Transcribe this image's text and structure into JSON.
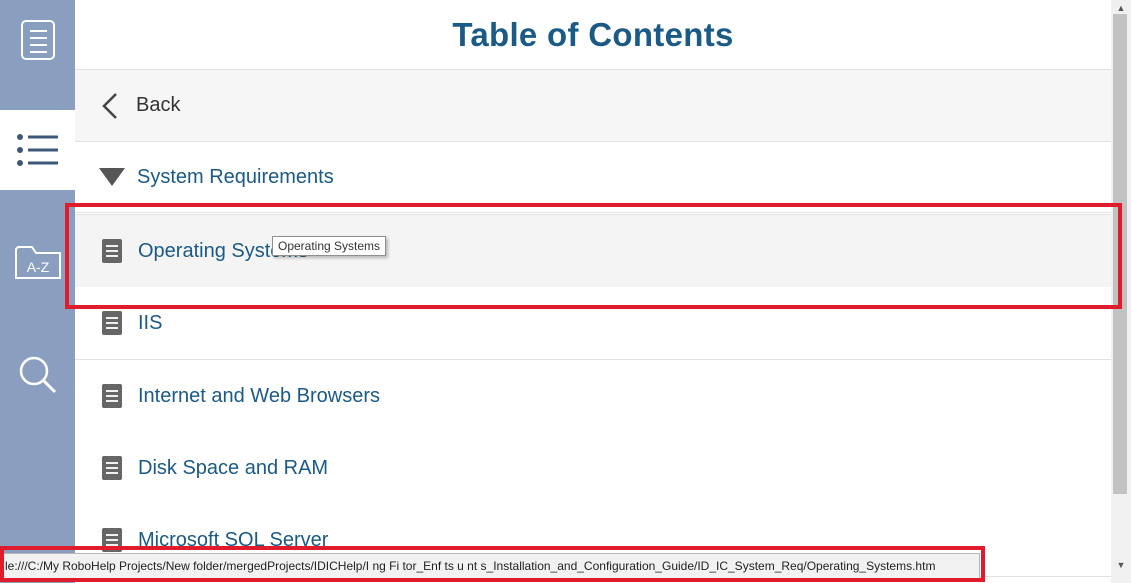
{
  "rail": {
    "items": [
      {
        "name": "contents-book",
        "icon": "book-icon"
      },
      {
        "name": "toc",
        "icon": "list-icon",
        "active": true
      },
      {
        "name": "index",
        "icon": "a-z-folder-icon",
        "label": "A-Z"
      },
      {
        "name": "search",
        "icon": "search-icon"
      }
    ]
  },
  "header": {
    "title": "Table of Contents"
  },
  "back": {
    "label": "Back"
  },
  "book": {
    "label": "System Requirements"
  },
  "topics": [
    {
      "label": "Operating Systems",
      "selected": true
    },
    {
      "label": "IIS"
    },
    {
      "label": "Internet and Web Browsers"
    },
    {
      "label": "Disk Space and RAM"
    },
    {
      "label": "Microsoft SQL Server"
    }
  ],
  "tooltip": "Operating Systems",
  "statusbar": {
    "url": "le:///C:/My RoboHelp Projects/New folder/mergedProjects/IDICHelp/I  ng  Fi  tor_Enf  ts  u  nt  s_Installation_and_Configuration_Guide/ID_IC_System_Req/Operating_Systems.htm"
  },
  "colors": {
    "rail": "#8a9fc0",
    "title": "#1a5a86",
    "highlight": "#e01b2b"
  }
}
